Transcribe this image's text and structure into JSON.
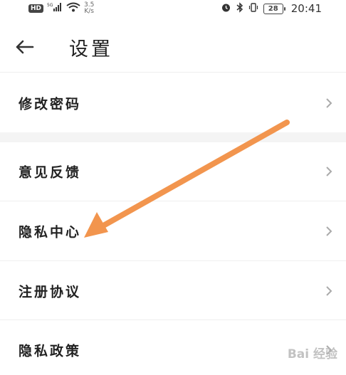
{
  "status_bar": {
    "hd": "HD",
    "signal": "5G",
    "speed": "3.5",
    "speed_unit": "K/s",
    "battery": "28",
    "time": "20:41"
  },
  "header": {
    "title": "设置"
  },
  "menu": {
    "items": [
      {
        "label": "修改密码"
      },
      {
        "label": "意见反馈"
      },
      {
        "label": "隐私中心"
      },
      {
        "label": "注册协议"
      },
      {
        "label": "隐私政策"
      }
    ]
  },
  "annotation": {
    "arrow_color": "#f2954e"
  },
  "watermark": {
    "text": "Bai 经验"
  }
}
